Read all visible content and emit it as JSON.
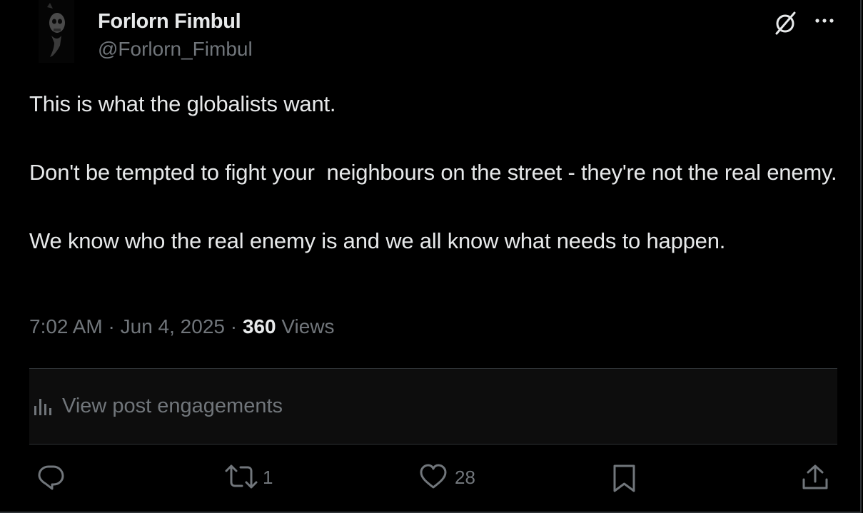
{
  "post": {
    "author": {
      "name": "Forlorn Fimbul",
      "handle": "@Forlorn_Fimbul",
      "avatar_icon": "dark-skull-avatar"
    },
    "paragraphs": [
      "This is what the globalists want.",
      "Don't be tempted to fight your  neighbours on the street - they're not the real enemy.",
      "We know who the real enemy is and we all know what needs to happen."
    ],
    "time": "7:02 AM",
    "separator": " · ",
    "date": "Jun 4, 2025",
    "views_count": "360",
    "views_label": "Views"
  },
  "engagements": {
    "label": "View post engagements",
    "icon": "bar-chart-icon"
  },
  "actions": {
    "reply": {
      "icon": "reply-icon",
      "count": ""
    },
    "repost": {
      "icon": "repost-icon",
      "count": "1"
    },
    "like": {
      "icon": "heart-icon",
      "count": "28"
    },
    "bookmark": {
      "icon": "bookmark-icon"
    },
    "share": {
      "icon": "share-icon"
    }
  },
  "header_icons": [
    "grok-icon",
    "more-icon"
  ],
  "colors": {
    "background": "#000000",
    "text": "#e7e9ea",
    "secondary": "#71767b",
    "border": "#2f3336"
  }
}
